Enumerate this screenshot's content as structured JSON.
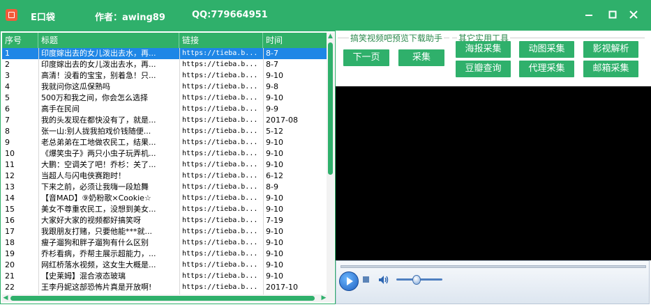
{
  "titlebar": {
    "app_name": "E口袋",
    "author": "作者：awing89",
    "qq": "QQ:779664951"
  },
  "table": {
    "columns": [
      "序号",
      "标题",
      "链接",
      "时间"
    ],
    "selected_index": 0,
    "rows": [
      {
        "no": "1",
        "title": "印度嫁出去的女儿泼出去水，再...",
        "link": "https://tieba.b...",
        "time": "8-7"
      },
      {
        "no": "2",
        "title": "印度嫁出去的女儿泼出去水，再...",
        "link": "https://tieba.b...",
        "time": "8-7"
      },
      {
        "no": "3",
        "title": "高清！没看的宝宝，别着急！只...",
        "link": "https://tieba.b...",
        "time": "9-10"
      },
      {
        "no": "4",
        "title": "我就问你这瓜保熟吗",
        "link": "https://tieba.b...",
        "time": "9-8"
      },
      {
        "no": "5",
        "title": "500万和我之间，你会怎么选择",
        "link": "https://tieba.b...",
        "time": "9-10"
      },
      {
        "no": "6",
        "title": "高手在民间",
        "link": "https://tieba.b...",
        "time": "9-9"
      },
      {
        "no": "7",
        "title": "我的头发现在都快没有了，就是...",
        "link": "https://tieba.b...",
        "time": "2017-08"
      },
      {
        "no": "8",
        "title": "张一山:别人拢我拍戏价钱随便...",
        "link": "https://tieba.b...",
        "time": "5-12"
      },
      {
        "no": "9",
        "title": "老总弟弟在工地做农民工，结果...",
        "link": "https://tieba.b...",
        "time": "9-10"
      },
      {
        "no": "10",
        "title": "《爆笑虫子》两只小虫子玩弄机...",
        "link": "https://tieba.b...",
        "time": "9-10"
      },
      {
        "no": "11",
        "title": "大鹏：空调关了吧！乔杉：关了...",
        "link": "https://tieba.b...",
        "time": "9-10"
      },
      {
        "no": "12",
        "title": "当超人与闪电侠赛跑时！",
        "link": "https://tieba.b...",
        "time": "6-12"
      },
      {
        "no": "13",
        "title": "下来之前，必须让我嗨一段尬舞",
        "link": "https://tieba.b...",
        "time": "8-9"
      },
      {
        "no": "14",
        "title": "【音MAD】⑨奶粉歌×Cookie☆",
        "link": "https://tieba.b...",
        "time": "9-10"
      },
      {
        "no": "15",
        "title": "美女不尊重农民工，没想到美女...",
        "link": "https://tieba.b...",
        "time": "9-10"
      },
      {
        "no": "16",
        "title": "大家好大家的视频都好搞笑呀",
        "link": "https://tieba.b...",
        "time": "7-19"
      },
      {
        "no": "17",
        "title": "我跟朋友打赌，只要他能***就...",
        "link": "https://tieba.b...",
        "time": "9-10"
      },
      {
        "no": "18",
        "title": "瘦子遛狗和胖子遛狗有什么区别",
        "link": "https://tieba.b...",
        "time": "9-10"
      },
      {
        "no": "19",
        "title": "乔杉看病，乔帮主展示超能力，...",
        "link": "https://tieba.b...",
        "time": "9-10"
      },
      {
        "no": "20",
        "title": "网红桥落水视频，这女生大概是...",
        "link": "https://tieba.b...",
        "time": "9-10"
      },
      {
        "no": "21",
        "title": "【史莱姆】混合液态玻璃",
        "link": "https://tieba.b...",
        "time": "9-10"
      },
      {
        "no": "22",
        "title": "王李丹妮这部恐怖片真是开放啊!",
        "link": "https://tieba.b...",
        "time": "2017-10"
      }
    ]
  },
  "download_group": {
    "title": "搞笑视频吧预览下载助手",
    "next_page": "下一页",
    "collect": "采集"
  },
  "tools_group": {
    "title": "其它实用工具",
    "buttons": [
      "海报采集",
      "动图采集",
      "影视解析",
      "豆瓣查询",
      "代理采集",
      "邮箱采集"
    ]
  },
  "player": {
    "volume": 0.42
  }
}
